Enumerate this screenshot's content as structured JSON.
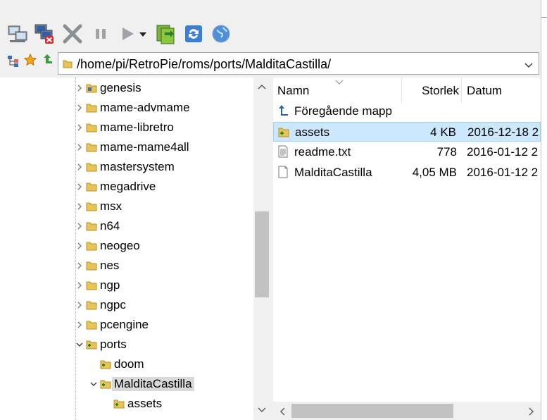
{
  "toolbar": {
    "buttons": [
      {
        "name": "connect-icon"
      },
      {
        "name": "disconnect-icon"
      },
      {
        "name": "cancel-icon"
      },
      {
        "name": "pause-icon"
      },
      {
        "name": "play-icon"
      },
      {
        "name": "play-dropdown-icon"
      },
      {
        "name": "refresh-green-icon"
      },
      {
        "name": "sync-icon"
      },
      {
        "name": "globe-icon"
      }
    ]
  },
  "pathbar": {
    "path": "/home/pi/RetroPie/roms/ports/MalditaCastilla/"
  },
  "tree": {
    "items": [
      {
        "label": "genesis",
        "expander": "collapsed",
        "level": 0
      },
      {
        "label": "mame-advmame",
        "expander": "collapsed",
        "level": 0
      },
      {
        "label": "mame-libretro",
        "expander": "collapsed",
        "level": 0
      },
      {
        "label": "mame-mame4all",
        "expander": "collapsed",
        "level": 0
      },
      {
        "label": "mastersystem",
        "expander": "collapsed",
        "level": 0
      },
      {
        "label": "megadrive",
        "expander": "collapsed",
        "level": 0
      },
      {
        "label": "msx",
        "expander": "collapsed",
        "level": 0
      },
      {
        "label": "n64",
        "expander": "collapsed",
        "level": 0
      },
      {
        "label": "neogeo",
        "expander": "collapsed",
        "level": 0
      },
      {
        "label": "nes",
        "expander": "collapsed",
        "level": 0
      },
      {
        "label": "ngp",
        "expander": "collapsed",
        "level": 0
      },
      {
        "label": "ngpc",
        "expander": "collapsed",
        "level": 0
      },
      {
        "label": "pcengine",
        "expander": "collapsed",
        "level": 0
      },
      {
        "label": "ports",
        "expander": "expanded",
        "level": 0
      },
      {
        "label": "doom",
        "expander": "none",
        "level": 1
      },
      {
        "label": "MalditaCastilla",
        "expander": "expanded",
        "level": 1,
        "selected": true
      },
      {
        "label": "assets",
        "expander": "none",
        "level": 2
      }
    ]
  },
  "list": {
    "columns": {
      "name": "Namn",
      "size": "Storlek",
      "date": "Datum"
    },
    "rows": [
      {
        "icon": "parent-folder-icon",
        "name": "Föregående mapp",
        "size": "",
        "date": ""
      },
      {
        "icon": "folder-icon",
        "name": "assets",
        "size": "4 KB",
        "date": "2016-12-18 2",
        "selected": true
      },
      {
        "icon": "text-file-icon",
        "name": "readme.txt",
        "size": "778",
        "date": "2016-01-12 2"
      },
      {
        "icon": "file-icon",
        "name": "MalditaCastilla",
        "size": "4,05 MB",
        "date": "2016-01-12 2"
      }
    ]
  },
  "colors": {
    "selection": "#cce8ff",
    "selection_border": "#99d1ff",
    "tree_selection": "#d9d9d9",
    "folder": "#e8c35a"
  }
}
